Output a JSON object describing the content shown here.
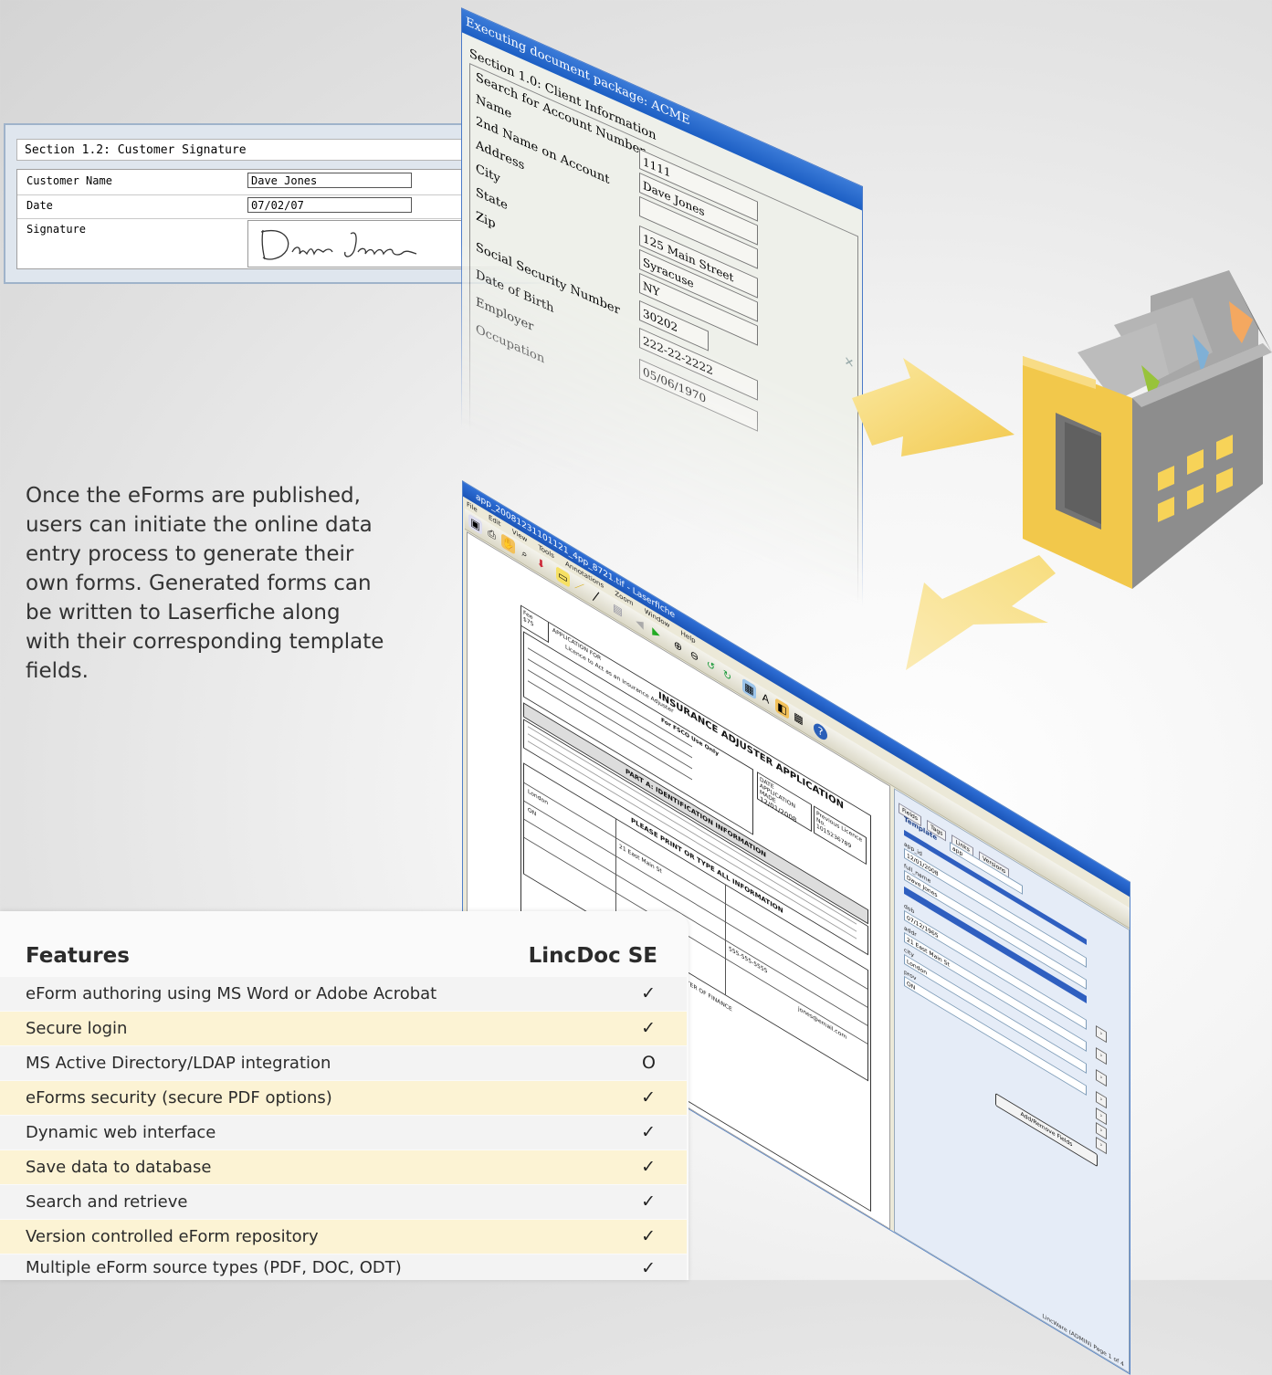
{
  "signature_panel": {
    "title": "Section 1.2: Customer Signature",
    "rows": [
      {
        "label": "Customer Name",
        "value": "Dave Jones"
      },
      {
        "label": "Date",
        "value": "07/02/07"
      },
      {
        "label": "Signature",
        "value": "Dave Jones"
      }
    ]
  },
  "package_window": {
    "title": "Executing document package: ACME",
    "section": "Section 1.0: Client Information",
    "labels": [
      "Search for Account Number",
      "Name",
      "2nd Name on Account",
      "Address",
      "City",
      "State",
      "Zip",
      "Social Security Number",
      "Date of Birth",
      "Employer",
      "Occupation"
    ],
    "values": [
      "1111",
      "Dave Jones",
      "",
      "125 Main Street",
      "Syracuse",
      "NY",
      "30202",
      "222-22-2222",
      "05/06/1970"
    ]
  },
  "intro_text": "Once the eForms are published, users can initiate the online data entry process to generate their own forms. Generated forms can be written to Laserfiche along with their corresponding template fields.",
  "laserfiche_window": {
    "title": "app_20081231101121_4pp_8721.tif - Laserfiche",
    "menu": [
      "File",
      "Edit",
      "View",
      "Tools",
      "Annotations",
      "Zoom",
      "Window",
      "Help"
    ],
    "document": {
      "heading": "INSURANCE ADJUSTER APPLICATION",
      "fee_label": "Fee",
      "fee_value": "$75",
      "form_label": "APPLICATION FOR",
      "form_value": "Licence to Act as an Insurance Adjuster",
      "office_use": "For FSCO Use Only",
      "date_label": "DATE APPLICATION MADE",
      "date_value": "12/01/2008",
      "licence_label": "Previous Licence No.",
      "licence_value": "1015236789",
      "part_a": "PART A: IDENTIFICATION INFORMATION",
      "print_note": "PLEASE PRINT OR TYPE ALL INFORMATION",
      "address": "21 East Main St",
      "city": "London",
      "province": "ON",
      "phone": "555-555-5555",
      "email": "jones@email.com",
      "footer": "THE MINISTER OF FINANCE"
    },
    "pane": {
      "tabs": [
        "Fields",
        "Tags",
        "Links",
        "Versions"
      ],
      "template_label": "Template",
      "template_value": "app",
      "fields": [
        {
          "label": "app_id",
          "value": "12/01/2008"
        },
        {
          "label": "full_name",
          "value": "Dave Jones"
        },
        {
          "label": "dob",
          "value": "07/12/1965"
        },
        {
          "label": "addr",
          "value": "21 East Main St"
        },
        {
          "label": "city",
          "value": "London"
        },
        {
          "label": "prov",
          "value": "ON"
        }
      ],
      "button": "Add/Remove Fields"
    },
    "status": "LincWare (ADMIN)   Page 1 of 4"
  },
  "features": {
    "header_feature": "Features",
    "header_product": "LincDoc SE",
    "rows": [
      {
        "feature": "eForm authoring using MS Word or Adobe Acrobat",
        "value": "✓"
      },
      {
        "feature": "Secure login",
        "value": "✓"
      },
      {
        "feature": "MS Active Directory/LDAP integration",
        "value": "O"
      },
      {
        "feature": "eForms security (secure PDF options)",
        "value": "✓"
      },
      {
        "feature": "Dynamic web interface",
        "value": "✓"
      },
      {
        "feature": "Save data to database",
        "value": "✓"
      },
      {
        "feature": "Search and retrieve",
        "value": "✓"
      },
      {
        "feature": "Version controlled eForm repository",
        "value": "✓"
      },
      {
        "feature": "Multiple eForm source types (PDF, DOC, ODT)",
        "value": "✓"
      }
    ]
  },
  "colors": {
    "arrow": "#f5d264",
    "building_front": "#f2c84b",
    "building_side": "#9c9c9c",
    "row_highlight": "#fcf3d4",
    "window_title": "#1d5fc4"
  }
}
